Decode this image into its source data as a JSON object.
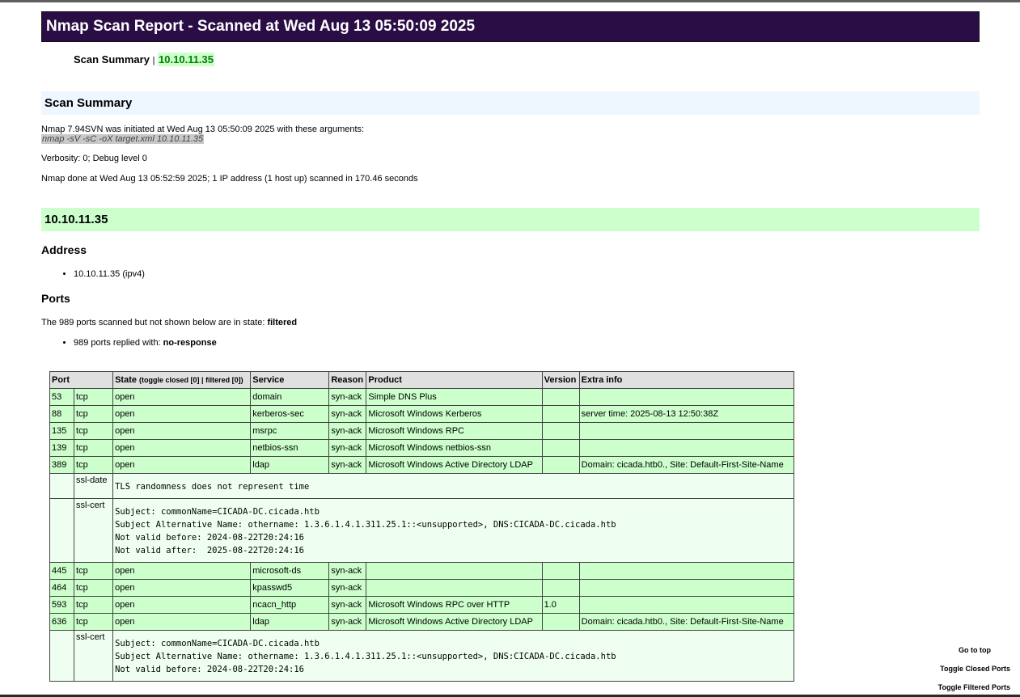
{
  "header": {
    "title": "Nmap Scan Report - Scanned at Wed Aug 13 05:50:09 2025"
  },
  "summary_line": {
    "label": "Scan Summary",
    "separator": "|",
    "host": "10.10.11.35"
  },
  "scan_summary": {
    "heading": "Scan Summary",
    "initiated": "Nmap 7.94SVN was initiated at Wed Aug 13 05:50:09 2025 with these arguments:",
    "arguments": "nmap -sV -sC -oX target.xml 10.10.11.35",
    "verbosity": "Verbosity: 0; Debug level 0",
    "done": "Nmap done at Wed Aug 13 05:52:59 2025; 1 IP address (1 host up) scanned in 170.46 seconds"
  },
  "host": {
    "heading": "10.10.11.35",
    "address_heading": "Address",
    "address": "10.10.11.35 (ipv4)",
    "ports_heading": "Ports",
    "ports_note_prefix": "The 989 ports scanned but not shown below are in state: ",
    "ports_note_state": "filtered",
    "replied_prefix": "989 ports replied with: ",
    "replied_reason": "no-response"
  },
  "table": {
    "headers": {
      "port": "Port",
      "state": "State",
      "toggle": "(toggle closed [0] | filtered [0])",
      "service": "Service",
      "reason": "Reason",
      "product": "Product",
      "version": "Version",
      "extra": "Extra info"
    },
    "rows": [
      {
        "port": "53",
        "proto": "tcp",
        "state": "open",
        "service": "domain",
        "reason": "syn-ack",
        "product": "Simple DNS Plus",
        "version": "",
        "extra": ""
      },
      {
        "port": "88",
        "proto": "tcp",
        "state": "open",
        "service": "kerberos-sec",
        "reason": "syn-ack",
        "product": "Microsoft Windows Kerberos",
        "version": "",
        "extra": "server time: 2025-08-13 12:50:38Z"
      },
      {
        "port": "135",
        "proto": "tcp",
        "state": "open",
        "service": "msrpc",
        "reason": "syn-ack",
        "product": "Microsoft Windows RPC",
        "version": "",
        "extra": ""
      },
      {
        "port": "139",
        "proto": "tcp",
        "state": "open",
        "service": "netbios-ssn",
        "reason": "syn-ack",
        "product": "Microsoft Windows netbios-ssn",
        "version": "",
        "extra": ""
      },
      {
        "port": "389",
        "proto": "tcp",
        "state": "open",
        "service": "ldap",
        "reason": "syn-ack",
        "product": "Microsoft Windows Active Directory LDAP",
        "version": "",
        "extra": "Domain: cicada.htb0., Site: Default-First-Site-Name"
      },
      {
        "port": "445",
        "proto": "tcp",
        "state": "open",
        "service": "microsoft-ds",
        "reason": "syn-ack",
        "product": "",
        "version": "",
        "extra": ""
      },
      {
        "port": "464",
        "proto": "tcp",
        "state": "open",
        "service": "kpasswd5",
        "reason": "syn-ack",
        "product": "",
        "version": "",
        "extra": ""
      },
      {
        "port": "593",
        "proto": "tcp",
        "state": "open",
        "service": "ncacn_http",
        "reason": "syn-ack",
        "product": "Microsoft Windows RPC over HTTP",
        "version": "1.0",
        "extra": ""
      },
      {
        "port": "636",
        "proto": "tcp",
        "state": "open",
        "service": "ldap",
        "reason": "syn-ack",
        "product": "Microsoft Windows Active Directory LDAP",
        "version": "",
        "extra": "Domain: cicada.htb0., Site: Default-First-Site-Name"
      }
    ],
    "scripts": {
      "ssl_date_name": "ssl-date",
      "ssl_date_output": "TLS randomness does not represent time",
      "ssl_cert_name": "ssl-cert",
      "ssl_cert_output": "Subject: commonName=CICADA-DC.cicada.htb\nSubject Alternative Name: othername: 1.3.6.1.4.1.311.25.1::<unsupported>, DNS:CICADA-DC.cicada.htb\nNot valid before: 2024-08-22T20:24:16\nNot valid after:  2025-08-22T20:24:16",
      "ssl_cert2_name": "ssl-cert",
      "ssl_cert2_output": "Subject: commonName=CICADA-DC.cicada.htb\nSubject Alternative Name: othername: 1.3.6.1.4.1.311.25.1::<unsupported>, DNS:CICADA-DC.cicada.htb\nNot valid before: 2024-08-22T20:24:16"
    }
  },
  "nav": {
    "top": "Go to top",
    "toggle_closed": "Toggle Closed Ports",
    "toggle_filtered": "Toggle Filtered Ports"
  }
}
